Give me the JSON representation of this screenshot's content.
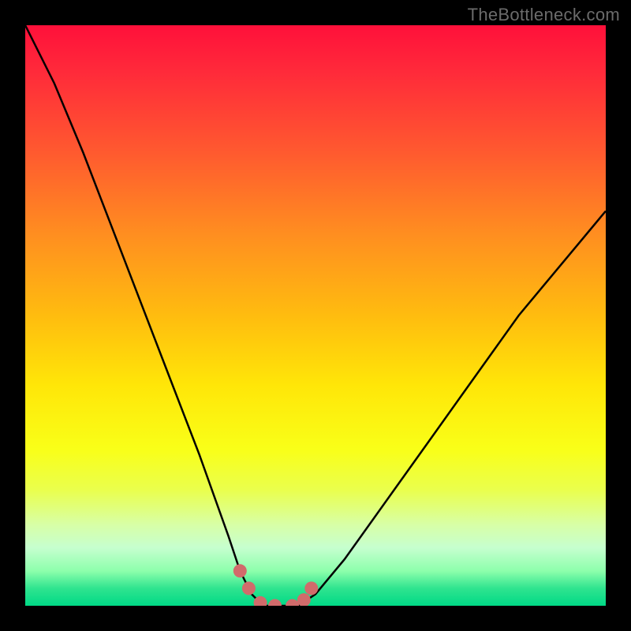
{
  "watermark": "TheBottleneck.com",
  "chart_data": {
    "type": "line",
    "title": "",
    "xlabel": "",
    "ylabel": "",
    "xlim": [
      0,
      100
    ],
    "ylim": [
      0,
      100
    ],
    "series": [
      {
        "name": "bottleneck-curve",
        "x": [
          0,
          5,
          10,
          15,
          20,
          25,
          30,
          35,
          37,
          39,
          41,
          43,
          45,
          47,
          50,
          55,
          60,
          65,
          70,
          75,
          80,
          85,
          90,
          95,
          100
        ],
        "y": [
          100,
          90,
          78,
          65,
          52,
          39,
          26,
          12,
          6,
          2,
          0,
          0,
          0,
          0,
          2,
          8,
          15,
          22,
          29,
          36,
          43,
          50,
          56,
          62,
          68
        ]
      }
    ],
    "markers": {
      "name": "curve-dots",
      "x": [
        37,
        38.5,
        40.5,
        43,
        46,
        48,
        49.3
      ],
      "y": [
        6,
        3,
        0.5,
        0,
        0,
        1,
        3
      ]
    },
    "annotations": []
  },
  "colors": {
    "curve": "#000000",
    "markers": "#d16b6b"
  }
}
